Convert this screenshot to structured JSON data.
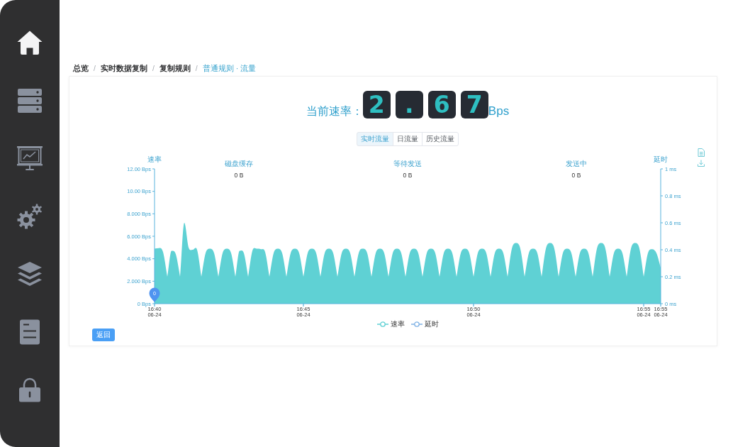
{
  "sidebar": {
    "items": [
      {
        "selected": true
      },
      {
        "selected": false
      },
      {
        "selected": false
      },
      {
        "selected": false
      },
      {
        "selected": false
      },
      {
        "selected": false
      },
      {
        "selected": false
      }
    ]
  },
  "breadcrumb": [
    {
      "label": "总览",
      "current": false
    },
    {
      "separator": "/",
      "label": "实时数据复制",
      "current": false
    },
    {
      "separator": "/",
      "label": "复制规则",
      "current": false
    },
    {
      "separator": "/",
      "label": "普通规则 · 流量",
      "current": true
    }
  ],
  "rate": {
    "label": "当前速率：",
    "digits": [
      "2",
      ".",
      "6",
      "7"
    ],
    "unit": "Bps"
  },
  "tabs": [
    {
      "label": "实时流量",
      "selected": true
    },
    {
      "label": "日流量",
      "selected": false
    },
    {
      "label": "历史流量",
      "selected": false
    }
  ],
  "chart": {
    "stats": [
      {
        "label": "磁盘缓存",
        "value": "0 B"
      },
      {
        "label": "等待发送",
        "value": "0 B"
      },
      {
        "label": "发送中",
        "value": "0 B"
      }
    ],
    "chart_data": {
      "type": "area",
      "ylabel": "速率",
      "y2label": "延时",
      "categories": [
        "16:40\n06-24",
        null,
        null,
        null,
        null,
        null,
        null,
        null,
        null,
        null,
        null,
        null,
        null,
        null,
        null,
        null,
        null,
        null,
        null,
        null,
        null,
        null,
        null,
        null,
        null,
        null,
        null,
        null,
        null,
        null,
        null,
        null,
        null,
        null,
        null,
        "16:45\n06-24",
        null,
        null,
        null,
        null,
        null,
        null,
        null,
        null,
        null,
        null,
        null,
        null,
        null,
        null,
        null,
        null,
        null,
        null,
        null,
        null,
        null,
        null,
        null,
        null,
        null,
        null,
        null,
        null,
        null,
        null,
        null,
        null,
        null,
        null,
        null,
        null,
        null,
        null,
        null,
        "16:50\n06-24",
        null,
        null,
        null,
        null,
        null,
        null,
        null,
        null,
        null,
        null,
        null,
        null,
        null,
        null,
        null,
        null,
        null,
        null,
        null,
        null,
        null,
        null,
        null,
        null,
        null,
        null,
        null,
        null,
        null,
        null,
        null,
        null,
        null,
        null,
        null,
        null,
        null,
        null,
        null,
        "16:55\n06-24",
        null,
        null,
        null,
        "16:55\n06-24"
      ],
      "series": [
        {
          "name": "速率",
          "color": "#5fd1d4",
          "values": [
            4.9,
            4.95,
            4.6,
            2.4,
            4.7,
            4.4,
            2.4,
            7.2,
            5.0,
            4.8,
            4.8,
            2.4,
            4.5,
            4.9,
            4.5,
            2.4,
            4.5,
            4.9,
            4.5,
            2.4,
            4.7,
            4.5,
            2.4,
            4.7,
            4.9,
            4.85,
            4.6,
            2.4,
            4.5,
            4.9,
            4.5,
            2.4,
            4.5,
            4.9,
            4.5,
            2.4,
            4.5,
            4.9,
            4.5,
            2.4,
            4.5,
            4.9,
            4.5,
            2.4,
            4.5,
            4.9,
            4.5,
            2.4,
            4.5,
            4.9,
            4.5,
            2.4,
            4.5,
            4.9,
            4.5,
            2.4,
            4.5,
            4.9,
            4.5,
            2.4,
            4.5,
            4.9,
            4.5,
            2.4,
            4.5,
            4.9,
            4.5,
            2.4,
            4.5,
            4.9,
            4.5,
            2.4,
            4.5,
            4.9,
            4.5,
            2.4,
            4.5,
            4.9,
            4.5,
            2.4,
            4.5,
            4.9,
            4.5,
            2.4,
            4.9,
            5.4,
            4.9,
            2.4,
            4.5,
            4.9,
            4.5,
            2.4,
            4.9,
            5.4,
            4.9,
            2.4,
            4.5,
            4.9,
            4.5,
            2.4,
            4.5,
            4.9,
            4.5,
            2.4,
            4.9,
            5.4,
            4.9,
            2.4,
            4.5,
            4.9,
            4.5,
            2.4,
            4.9,
            5.4,
            4.9,
            2.4,
            4.5,
            4.85,
            4.5,
            3.2
          ]
        },
        {
          "name": "延时",
          "color": "#7fb2e5",
          "values": [
            null,
            null,
            null,
            null,
            null,
            null,
            null,
            null,
            null,
            null,
            null,
            null,
            null,
            null,
            null,
            null,
            null,
            null,
            null,
            null,
            null,
            null,
            null,
            null,
            null,
            null,
            null,
            null,
            null,
            null,
            null,
            null,
            null,
            null,
            null,
            null,
            null,
            null,
            null,
            null,
            null,
            null,
            null,
            null,
            null,
            null,
            null,
            null,
            null,
            null,
            null,
            null,
            null,
            null,
            null,
            null,
            null,
            null,
            null,
            null,
            null,
            null,
            null,
            null,
            null,
            null,
            null,
            null,
            null,
            null,
            null,
            null,
            null,
            null,
            null,
            null,
            null,
            null,
            null,
            null,
            null,
            null,
            null,
            null,
            null,
            null,
            null,
            null,
            null,
            null,
            null,
            null,
            null,
            null,
            null,
            null,
            null,
            null,
            null,
            null,
            null,
            null,
            null,
            null,
            null,
            null,
            null,
            null,
            null,
            null,
            null,
            null,
            null,
            null,
            null,
            null,
            null,
            null,
            null,
            null
          ]
        }
      ],
      "ylim": [
        0,
        12
      ],
      "y2lim": [
        0,
        1
      ],
      "yticks": [
        {
          "value": 0,
          "label": "0 Bps"
        },
        {
          "value": 2,
          "label": "2.000 Bps"
        },
        {
          "value": 4,
          "label": "4.000 Bps"
        },
        {
          "value": 6,
          "label": "6.000 Bps"
        },
        {
          "value": 8,
          "label": "8.000 Bps"
        },
        {
          "value": 10,
          "label": "10.00 Bps"
        },
        {
          "value": 12,
          "label": "12.00 Bps"
        }
      ],
      "y2ticks": [
        {
          "value": 0,
          "label": "0 ms"
        },
        {
          "value": 0.2,
          "label": "0.2 ms"
        },
        {
          "value": 0.4,
          "label": "0.4 ms"
        },
        {
          "value": 0.6,
          "label": "0.6 ms"
        },
        {
          "value": 0.8,
          "label": "0.8 ms"
        },
        {
          "value": 1,
          "label": "1 ms"
        }
      ],
      "annotations": [
        {
          "x": "16:40\n06-24",
          "y": 0,
          "text": "0"
        }
      ]
    }
  },
  "back_button": {
    "label": "返回"
  }
}
